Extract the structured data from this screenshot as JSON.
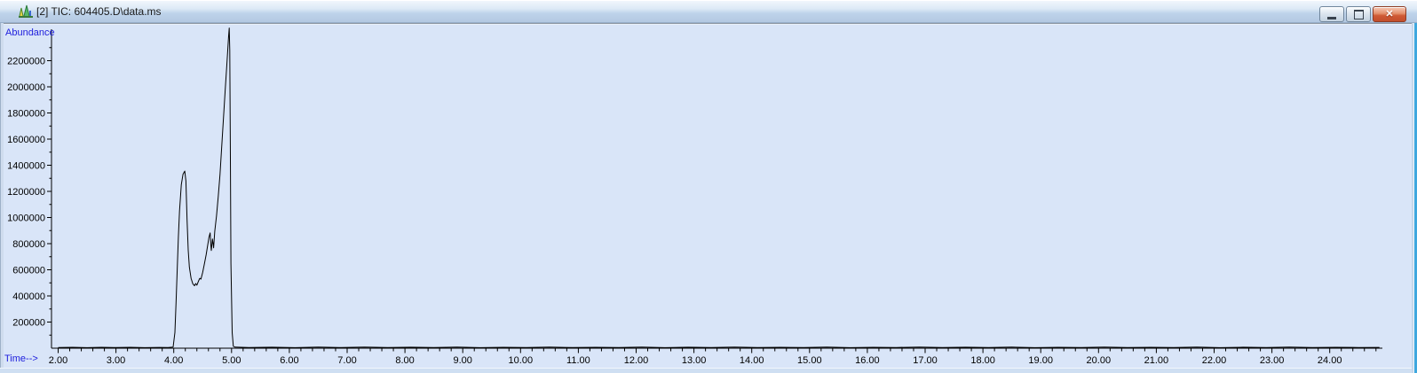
{
  "window": {
    "title": "[2] TIC: 604405.D\\data.ms",
    "icon": "chromatogram-icon",
    "controls": {
      "minimize": "minimize",
      "maximize": "maximize",
      "close": "close",
      "close_glyph": "✕"
    }
  },
  "chart_data": {
    "type": "line",
    "title": "TIC: 604405.D\\data.ms",
    "ylabel": "Abundance",
    "xlabel": "Time-->",
    "line_color": "#000000",
    "axis_label_color": "#2020dd",
    "tick_label_color": "#000000",
    "background_color": "#d9e5f8",
    "grid": false,
    "x_axis": {
      "min": 2.0,
      "max": 24.9,
      "major_tick_step": 1.0,
      "minor_tick_step": 0.2,
      "tick_label_format": "0.00",
      "major_ticks": [
        2,
        3,
        4,
        5,
        6,
        7,
        8,
        9,
        10,
        11,
        12,
        13,
        14,
        15,
        16,
        17,
        18,
        19,
        20,
        21,
        22,
        23,
        24
      ]
    },
    "y_axis": {
      "min": 0,
      "max": 2480000,
      "major_tick_step": 200000,
      "minor_tick_step": 100000,
      "major_ticks": [
        200000,
        400000,
        600000,
        800000,
        1000000,
        1200000,
        1400000,
        1600000,
        1800000,
        2000000,
        2200000
      ]
    },
    "peaks": [
      {
        "time": 4.19,
        "abundance": 1355000
      },
      {
        "time": 4.96,
        "abundance": 2450000
      }
    ],
    "trace": [
      [
        2.0,
        5000
      ],
      [
        2.25,
        7000
      ],
      [
        2.5,
        4000
      ],
      [
        2.75,
        6500
      ],
      [
        3.0,
        4500
      ],
      [
        3.25,
        7000
      ],
      [
        3.5,
        4000
      ],
      [
        3.75,
        6000
      ],
      [
        3.9,
        5000
      ],
      [
        3.99,
        9000
      ],
      [
        4.02,
        120000
      ],
      [
        4.04,
        350000
      ],
      [
        4.06,
        600000
      ],
      [
        4.08,
        850000
      ],
      [
        4.1,
        1050000
      ],
      [
        4.13,
        1250000
      ],
      [
        4.16,
        1330000
      ],
      [
        4.19,
        1355000
      ],
      [
        4.21,
        1280000
      ],
      [
        4.23,
        980000
      ],
      [
        4.25,
        750000
      ],
      [
        4.27,
        620000
      ],
      [
        4.3,
        535000
      ],
      [
        4.33,
        492000
      ],
      [
        4.36,
        478000
      ],
      [
        4.38,
        495000
      ],
      [
        4.4,
        482000
      ],
      [
        4.43,
        515000
      ],
      [
        4.45,
        535000
      ],
      [
        4.47,
        528000
      ],
      [
        4.5,
        580000
      ],
      [
        4.53,
        645000
      ],
      [
        4.56,
        715000
      ],
      [
        4.59,
        795000
      ],
      [
        4.61,
        850000
      ],
      [
        4.63,
        882000
      ],
      [
        4.64,
        795000
      ],
      [
        4.65,
        748000
      ],
      [
        4.67,
        835000
      ],
      [
        4.69,
        768000
      ],
      [
        4.71,
        895000
      ],
      [
        4.74,
        1015000
      ],
      [
        4.77,
        1160000
      ],
      [
        4.8,
        1330000
      ],
      [
        4.83,
        1540000
      ],
      [
        4.86,
        1760000
      ],
      [
        4.89,
        1970000
      ],
      [
        4.92,
        2180000
      ],
      [
        4.95,
        2390000
      ],
      [
        4.96,
        2450000
      ],
      [
        4.97,
        2280000
      ],
      [
        4.98,
        1450000
      ],
      [
        4.99,
        650000
      ],
      [
        5.01,
        120000
      ],
      [
        5.03,
        15000
      ],
      [
        5.06,
        8000
      ],
      [
        5.3,
        5000
      ],
      [
        5.7,
        7500
      ],
      [
        6.1,
        4000
      ],
      [
        6.5,
        8000
      ],
      [
        6.9,
        5000
      ],
      [
        7.3,
        9000
      ],
      [
        7.7,
        4500
      ],
      [
        8.1,
        7500
      ],
      [
        8.5,
        5000
      ],
      [
        8.9,
        8000
      ],
      [
        9.3,
        4000
      ],
      [
        9.7,
        7000
      ],
      [
        10.1,
        5500
      ],
      [
        10.5,
        8500
      ],
      [
        10.9,
        4500
      ],
      [
        11.3,
        7000
      ],
      [
        11.7,
        5000
      ],
      [
        12.1,
        9000
      ],
      [
        12.5,
        4000
      ],
      [
        12.9,
        7500
      ],
      [
        13.3,
        5500
      ],
      [
        13.7,
        8000
      ],
      [
        14.1,
        4500
      ],
      [
        14.5,
        7000
      ],
      [
        14.9,
        5000
      ],
      [
        15.3,
        8500
      ],
      [
        15.7,
        4000
      ],
      [
        16.1,
        7000
      ],
      [
        16.5,
        5500
      ],
      [
        16.9,
        9000
      ],
      [
        17.3,
        4500
      ],
      [
        17.7,
        7500
      ],
      [
        18.1,
        5000
      ],
      [
        18.5,
        8000
      ],
      [
        18.9,
        4000
      ],
      [
        19.3,
        7000
      ],
      [
        19.7,
        5500
      ],
      [
        20.1,
        8500
      ],
      [
        20.5,
        4500
      ],
      [
        20.9,
        7000
      ],
      [
        21.3,
        5000
      ],
      [
        21.7,
        9000
      ],
      [
        22.1,
        4000
      ],
      [
        22.5,
        7500
      ],
      [
        22.9,
        5500
      ],
      [
        23.3,
        8000
      ],
      [
        23.7,
        4500
      ],
      [
        24.1,
        7000
      ],
      [
        24.5,
        5500
      ],
      [
        24.86,
        6000
      ]
    ]
  }
}
